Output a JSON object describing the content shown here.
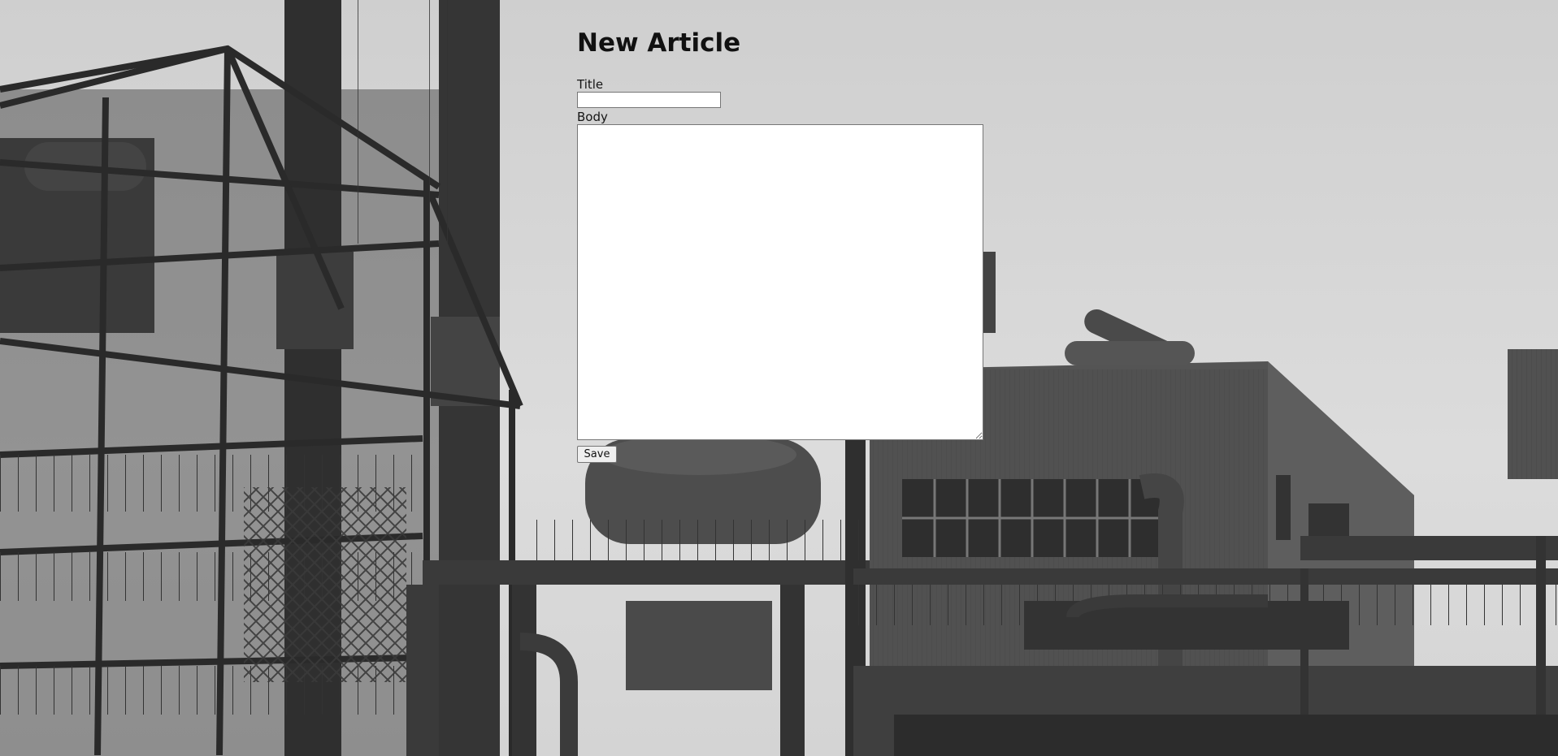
{
  "page": {
    "heading": "New Article"
  },
  "form": {
    "title_label": "Title",
    "title_value": "",
    "body_label": "Body",
    "body_value": "",
    "save_label": "Save"
  },
  "background": {
    "description_icon": "industrial-plant-photo",
    "sky_color": "#d6d6d6",
    "structure_color": "#2e2e2e"
  }
}
